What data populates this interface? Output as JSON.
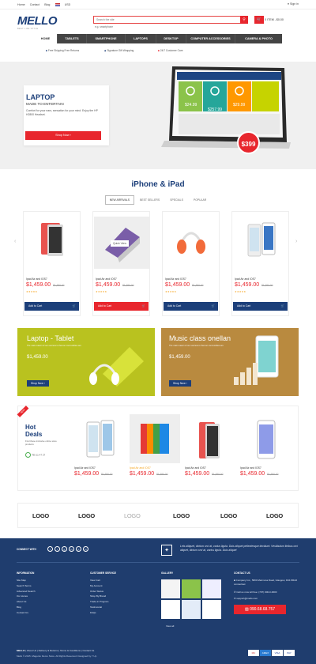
{
  "topbar": {
    "links": [
      "Home",
      "Contact",
      "Blog"
    ],
    "currency": "USD",
    "signin": "Sign in"
  },
  "header": {
    "logo": "MELLO",
    "logo_sub": "BEST LIFE STYLE",
    "search_placeholder": "Search the site",
    "search_hint": "e.g. smartphone",
    "cart": "0 ITEM - $0.00"
  },
  "nav": {
    "items": [
      "HOME",
      "TABLETS",
      "SMARTPHONE",
      "LAPTOPS",
      "DESKTOP",
      "COMPUTER ACCESSORIES",
      "CAMERA & PHOTO"
    ]
  },
  "services": [
    "Free Shipping Free Returns",
    "Signature Gift Wrapping",
    "24/7 Customer Care"
  ],
  "hero": {
    "title": "LAPTOP",
    "subtitle": "MADE TO ENTERTAIN",
    "desc": "Comfort for your ears, sensation for your mind. Enjoy the HP H2800 Headset.",
    "cta": "Shop Now",
    "price_badge": "$399",
    "screen_prices": [
      "$24.99",
      "$257.99",
      "$29.99"
    ]
  },
  "iphone_section": {
    "title": "iPhone & iPad",
    "tabs": [
      "NEW ARRIVALS",
      "BEST SELLERS",
      "SPECIALS",
      "POPULAR"
    ],
    "quick_view": "Quick View",
    "products": [
      {
        "name": "Ipad Air and IOS7",
        "price": "$1,459.00",
        "old": "$1,650.00",
        "btn": "Add to Cart",
        "red": false
      },
      {
        "name": "Ipad Air and IOS7",
        "price": "$1,459.00",
        "old": "$1,650.00",
        "btn": "Add to Cart",
        "red": true
      },
      {
        "name": "Ipad Air and IOS7",
        "price": "$1,459.00",
        "old": "$1,650.00",
        "btn": "Add to Cart",
        "red": false
      },
      {
        "name": "Ipad Air and IOS7",
        "price": "$1,459.00",
        "old": "$1,650.00",
        "btn": "Add to Cart",
        "red": false
      }
    ]
  },
  "banners": [
    {
      "title": "Laptop - Tablet",
      "sub": "The main reason of our success is that our commodities are",
      "price": "$1,459.00",
      "btn": "Shop Now",
      "color": "#b9c21f"
    },
    {
      "title": "Music class onellan",
      "sub": "The main reason of our success is that our commodities are",
      "price": "$1,459.00",
      "btn": "Shop Now",
      "color": "#b98a3f"
    }
  ],
  "hot_deals": {
    "ribbon": "NEW",
    "title": "Hot",
    "title2": "Deals",
    "desc": "Find these inclusive online store products",
    "timer": [
      "795",
      "11",
      "47",
      "27"
    ],
    "products": [
      {
        "name": "Ipad Air and IOS7",
        "price": "$1,459.00",
        "old": "$1,650.00"
      },
      {
        "name": "Ipad Air and IOS7",
        "price": "$1,459.00",
        "old": "$1,650.00"
      },
      {
        "name": "Ipad Air and IOS7",
        "price": "$1,459.00",
        "old": "$1,650.00"
      },
      {
        "name": "Ipad Air and IOS7",
        "price": "$1,459.00",
        "old": "$1,650.00"
      }
    ]
  },
  "brand_logos": [
    "LOGO",
    "LOGO",
    "LOGO",
    "LOGO",
    "LOGO",
    "LOGO"
  ],
  "footer": {
    "connect": "CONNECT WITH",
    "social": [
      "f",
      "t",
      "g",
      "in",
      "p",
      "in"
    ],
    "tweet": "Lets alliquet, dictum orci at, varius ligula. Duis aliquet pellentesque tincidunt. Vestibulum finibus orci aliquet, dictum orci at, varius ligula. Duis aliquet",
    "information": {
      "title": "INFORMATION",
      "items": [
        "Site Map",
        "Search Terms",
        "Advanced Search",
        "Our stores",
        "About Us",
        "Blog",
        "Contact Us"
      ]
    },
    "customer": {
      "title": "CUSTOMER SERVICE",
      "items": [
        "View Cart",
        "My Account",
        "Order Status",
        "Shop By Brand",
        "Trade-in Program",
        "Testimonial",
        "FAQs"
      ]
    },
    "gallery": {
      "title": "GALLERY",
      "view_all": "View all"
    },
    "contact": {
      "title": "CONTACT US",
      "address": "Company Inc., 5800 Marmona Road, Glasgow, D04 89GR connectset",
      "call": "Call us now toll free: (707) 000-0-0000",
      "email": "support@mello.com",
      "phone": "090.68.68.757"
    },
    "bottom_links": [
      "MELLO",
      "About Us",
      "Delivery & Returns",
      "Terms & Conditions",
      "Contact Us"
    ],
    "copyright": "Mello © 2015. Magento Demo Store. All Rights Reserved. Designed by 7 Up",
    "payments": [
      "MC",
      "AMEX",
      "VISA",
      "PAY"
    ]
  }
}
